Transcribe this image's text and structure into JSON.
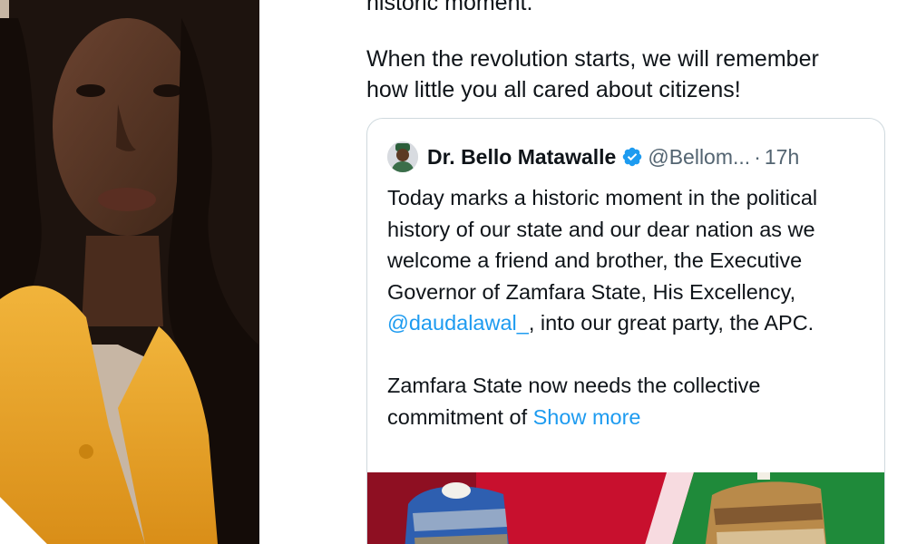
{
  "tweet": {
    "top_fragment": "historic moment.",
    "text": "When the revolution starts, we will remember\nhow little you all cared about citizens!"
  },
  "quote": {
    "display_name": "Dr. Bello Matawalle",
    "handle": "@Bellom...",
    "separator": "·",
    "time": "17h",
    "body_part1": "Today marks a historic moment in the political history of our state and our dear nation as we welcome a friend and brother, the Executive Governor of Zamfara State, His Excellency, ",
    "mention": "@daudalawal_",
    "body_part2": ", into our great party, the APC.",
    "body_para2": "Zamfara State now needs the collective commitment of ",
    "show_more": "Show more"
  },
  "colors": {
    "link": "#1d9bf0",
    "verified": "#1d9bf0",
    "text": "#0f1419",
    "muted": "#536471",
    "border": "#cfd9de",
    "photo_top": "#f0a326",
    "media_bg": "#c8102e"
  },
  "icons": {
    "verified": "verified-badge-icon"
  }
}
